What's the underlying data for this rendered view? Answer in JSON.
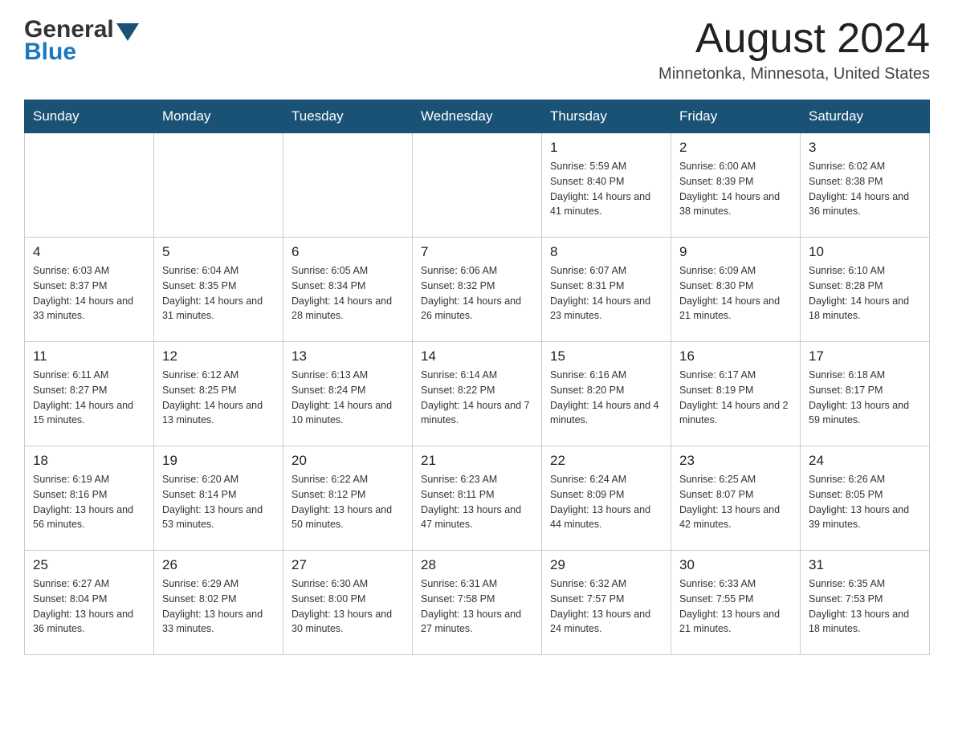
{
  "header": {
    "logo": {
      "general": "General",
      "blue": "Blue"
    },
    "title": "August 2024",
    "location": "Minnetonka, Minnesota, United States"
  },
  "calendar": {
    "days_of_week": [
      "Sunday",
      "Monday",
      "Tuesday",
      "Wednesday",
      "Thursday",
      "Friday",
      "Saturday"
    ],
    "weeks": [
      [
        {
          "day": "",
          "info": ""
        },
        {
          "day": "",
          "info": ""
        },
        {
          "day": "",
          "info": ""
        },
        {
          "day": "",
          "info": ""
        },
        {
          "day": "1",
          "info": "Sunrise: 5:59 AM\nSunset: 8:40 PM\nDaylight: 14 hours and 41 minutes."
        },
        {
          "day": "2",
          "info": "Sunrise: 6:00 AM\nSunset: 8:39 PM\nDaylight: 14 hours and 38 minutes."
        },
        {
          "day": "3",
          "info": "Sunrise: 6:02 AM\nSunset: 8:38 PM\nDaylight: 14 hours and 36 minutes."
        }
      ],
      [
        {
          "day": "4",
          "info": "Sunrise: 6:03 AM\nSunset: 8:37 PM\nDaylight: 14 hours and 33 minutes."
        },
        {
          "day": "5",
          "info": "Sunrise: 6:04 AM\nSunset: 8:35 PM\nDaylight: 14 hours and 31 minutes."
        },
        {
          "day": "6",
          "info": "Sunrise: 6:05 AM\nSunset: 8:34 PM\nDaylight: 14 hours and 28 minutes."
        },
        {
          "day": "7",
          "info": "Sunrise: 6:06 AM\nSunset: 8:32 PM\nDaylight: 14 hours and 26 minutes."
        },
        {
          "day": "8",
          "info": "Sunrise: 6:07 AM\nSunset: 8:31 PM\nDaylight: 14 hours and 23 minutes."
        },
        {
          "day": "9",
          "info": "Sunrise: 6:09 AM\nSunset: 8:30 PM\nDaylight: 14 hours and 21 minutes."
        },
        {
          "day": "10",
          "info": "Sunrise: 6:10 AM\nSunset: 8:28 PM\nDaylight: 14 hours and 18 minutes."
        }
      ],
      [
        {
          "day": "11",
          "info": "Sunrise: 6:11 AM\nSunset: 8:27 PM\nDaylight: 14 hours and 15 minutes."
        },
        {
          "day": "12",
          "info": "Sunrise: 6:12 AM\nSunset: 8:25 PM\nDaylight: 14 hours and 13 minutes."
        },
        {
          "day": "13",
          "info": "Sunrise: 6:13 AM\nSunset: 8:24 PM\nDaylight: 14 hours and 10 minutes."
        },
        {
          "day": "14",
          "info": "Sunrise: 6:14 AM\nSunset: 8:22 PM\nDaylight: 14 hours and 7 minutes."
        },
        {
          "day": "15",
          "info": "Sunrise: 6:16 AM\nSunset: 8:20 PM\nDaylight: 14 hours and 4 minutes."
        },
        {
          "day": "16",
          "info": "Sunrise: 6:17 AM\nSunset: 8:19 PM\nDaylight: 14 hours and 2 minutes."
        },
        {
          "day": "17",
          "info": "Sunrise: 6:18 AM\nSunset: 8:17 PM\nDaylight: 13 hours and 59 minutes."
        }
      ],
      [
        {
          "day": "18",
          "info": "Sunrise: 6:19 AM\nSunset: 8:16 PM\nDaylight: 13 hours and 56 minutes."
        },
        {
          "day": "19",
          "info": "Sunrise: 6:20 AM\nSunset: 8:14 PM\nDaylight: 13 hours and 53 minutes."
        },
        {
          "day": "20",
          "info": "Sunrise: 6:22 AM\nSunset: 8:12 PM\nDaylight: 13 hours and 50 minutes."
        },
        {
          "day": "21",
          "info": "Sunrise: 6:23 AM\nSunset: 8:11 PM\nDaylight: 13 hours and 47 minutes."
        },
        {
          "day": "22",
          "info": "Sunrise: 6:24 AM\nSunset: 8:09 PM\nDaylight: 13 hours and 44 minutes."
        },
        {
          "day": "23",
          "info": "Sunrise: 6:25 AM\nSunset: 8:07 PM\nDaylight: 13 hours and 42 minutes."
        },
        {
          "day": "24",
          "info": "Sunrise: 6:26 AM\nSunset: 8:05 PM\nDaylight: 13 hours and 39 minutes."
        }
      ],
      [
        {
          "day": "25",
          "info": "Sunrise: 6:27 AM\nSunset: 8:04 PM\nDaylight: 13 hours and 36 minutes."
        },
        {
          "day": "26",
          "info": "Sunrise: 6:29 AM\nSunset: 8:02 PM\nDaylight: 13 hours and 33 minutes."
        },
        {
          "day": "27",
          "info": "Sunrise: 6:30 AM\nSunset: 8:00 PM\nDaylight: 13 hours and 30 minutes."
        },
        {
          "day": "28",
          "info": "Sunrise: 6:31 AM\nSunset: 7:58 PM\nDaylight: 13 hours and 27 minutes."
        },
        {
          "day": "29",
          "info": "Sunrise: 6:32 AM\nSunset: 7:57 PM\nDaylight: 13 hours and 24 minutes."
        },
        {
          "day": "30",
          "info": "Sunrise: 6:33 AM\nSunset: 7:55 PM\nDaylight: 13 hours and 21 minutes."
        },
        {
          "day": "31",
          "info": "Sunrise: 6:35 AM\nSunset: 7:53 PM\nDaylight: 13 hours and 18 minutes."
        }
      ]
    ]
  }
}
